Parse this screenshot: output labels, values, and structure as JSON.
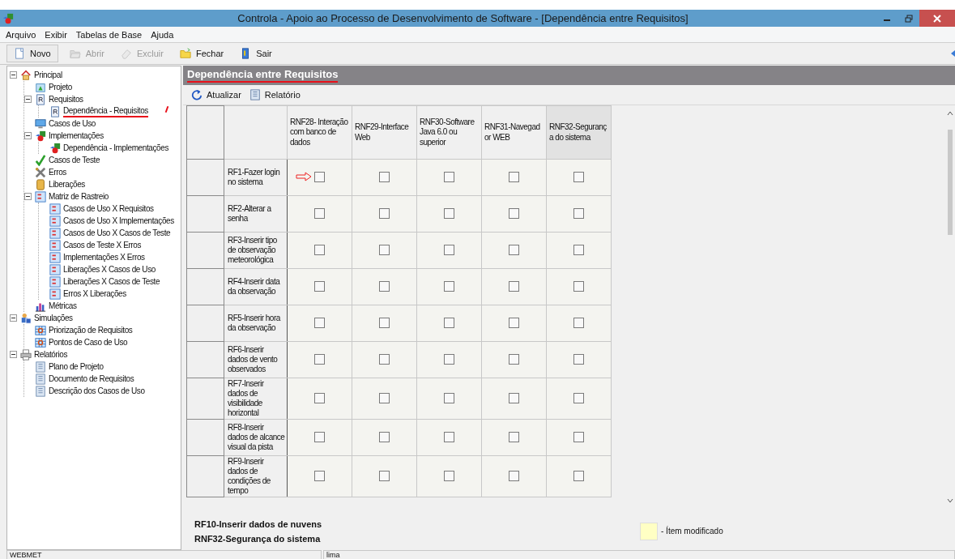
{
  "window": {
    "title": "Controla - Apoio ao Processo de Desenvolvimento de Software - [Dependência entre Requisitos]"
  },
  "menu": [
    "Arquivo",
    "Exibir",
    "Tabelas de Base",
    "Ajuda"
  ],
  "toolbar": [
    {
      "label": "Novo",
      "disabled": false
    },
    {
      "label": "Abrir",
      "disabled": true
    },
    {
      "label": "Excluir",
      "disabled": true
    },
    {
      "label": "Fechar",
      "disabled": false
    },
    {
      "label": "Sair",
      "disabled": false
    }
  ],
  "tree": [
    {
      "label": "Principal",
      "expanded": true,
      "children": [
        {
          "label": "Projeto"
        },
        {
          "label": "Requisitos",
          "expanded": true,
          "children": [
            {
              "label": "Dependência - Requisitos",
              "annotated": true
            }
          ]
        },
        {
          "label": "Casos de Uso"
        },
        {
          "label": "Implementações",
          "expanded": true,
          "children": [
            {
              "label": "Dependência - Implementações"
            }
          ]
        },
        {
          "label": "Casos de Teste"
        },
        {
          "label": "Erros"
        },
        {
          "label": "Liberações"
        },
        {
          "label": "Matriz de Rastreio",
          "expanded": true,
          "children": [
            {
              "label": "Casos de Uso X Requisitos"
            },
            {
              "label": "Casos de Uso X Implementações"
            },
            {
              "label": "Casos de Uso X Casos de Teste"
            },
            {
              "label": "Casos de Teste X Erros"
            },
            {
              "label": "Implementações X Erros"
            },
            {
              "label": "Liberações X Casos de Uso"
            },
            {
              "label": "Liberações X Casos de Teste"
            },
            {
              "label": "Erros X Liberações"
            }
          ]
        },
        {
          "label": "Métricas"
        }
      ]
    },
    {
      "label": "Simulações",
      "expanded": true,
      "children": [
        {
          "label": "Priorização de Requisitos"
        },
        {
          "label": "Pontos de Caso de Uso"
        }
      ]
    },
    {
      "label": "Relatórios",
      "expanded": true,
      "children": [
        {
          "label": "Plano de Projeto"
        },
        {
          "label": "Documento de Requisitos"
        },
        {
          "label": "Descrição dos Casos de Uso"
        }
      ]
    }
  ],
  "panel": {
    "title": "Dependência entre Requisitos",
    "annotated": true,
    "actions": [
      {
        "label": "Atualizar"
      },
      {
        "label": "Relatório"
      }
    ],
    "grid": {
      "columns": [
        {
          "label": "RNF28- Interação com banco de dados",
          "selected": false
        },
        {
          "label": "RNF29-Interface Web",
          "selected": false
        },
        {
          "label": "RNF30-Software Java  6.0  ou superior",
          "selected": false
        },
        {
          "label": "RNF31-Navegad or WEB",
          "selected": false
        },
        {
          "label": "RNF32-Seguranç a do sistema",
          "selected": true
        }
      ],
      "rows": [
        {
          "label": "RF1-Fazer login no sistema",
          "cells": [
            {
              "checked": false,
              "arrow": true
            },
            {
              "checked": false
            },
            {
              "checked": false
            },
            {
              "checked": false
            },
            {
              "checked": false
            }
          ]
        },
        {
          "label": "RF2-Alterar a senha",
          "cells": [
            {
              "checked": false
            },
            {
              "checked": false
            },
            {
              "checked": false
            },
            {
              "checked": false
            },
            {
              "checked": false
            }
          ]
        },
        {
          "label": "RF3-Inserir tipo de observação meteorológica",
          "cells": [
            {
              "checked": false
            },
            {
              "checked": false
            },
            {
              "checked": false
            },
            {
              "checked": false
            },
            {
              "checked": false
            }
          ]
        },
        {
          "label": "RF4-Inserir data da observação",
          "cells": [
            {
              "checked": false
            },
            {
              "checked": false
            },
            {
              "checked": false
            },
            {
              "checked": false
            },
            {
              "checked": false
            }
          ]
        },
        {
          "label": "RF5-Inserir hora da observação",
          "cells": [
            {
              "checked": false
            },
            {
              "checked": false
            },
            {
              "checked": false
            },
            {
              "checked": false
            },
            {
              "checked": false
            }
          ]
        },
        {
          "label": "RF6-Inserir dados de vento observados",
          "cells": [
            {
              "checked": false
            },
            {
              "checked": false
            },
            {
              "checked": false
            },
            {
              "checked": false
            },
            {
              "checked": false
            }
          ]
        },
        {
          "label": "RF7-Inserir dados de visibilidade horizontal",
          "cells": [
            {
              "checked": false
            },
            {
              "checked": false
            },
            {
              "checked": false
            },
            {
              "checked": false
            },
            {
              "checked": false
            }
          ]
        },
        {
          "label": "RF8-Inserir dados de alcance visual da pista",
          "cells": [
            {
              "checked": false
            },
            {
              "checked": false
            },
            {
              "checked": false
            },
            {
              "checked": false
            },
            {
              "checked": false
            }
          ]
        },
        {
          "label": "RF9-Inserir dados de condições de tempo",
          "cells": [
            {
              "checked": false
            },
            {
              "checked": false
            },
            {
              "checked": false
            },
            {
              "checked": false
            },
            {
              "checked": false
            }
          ]
        }
      ]
    },
    "current": [
      "RF10-Inserir dados de nuvens",
      "RNF32-Segurança do sistema"
    ],
    "legend": {
      "color": "#ffffc4",
      "label": "- Ítem modificado"
    }
  },
  "status_bar": [
    "WEBMET",
    "lima"
  ]
}
